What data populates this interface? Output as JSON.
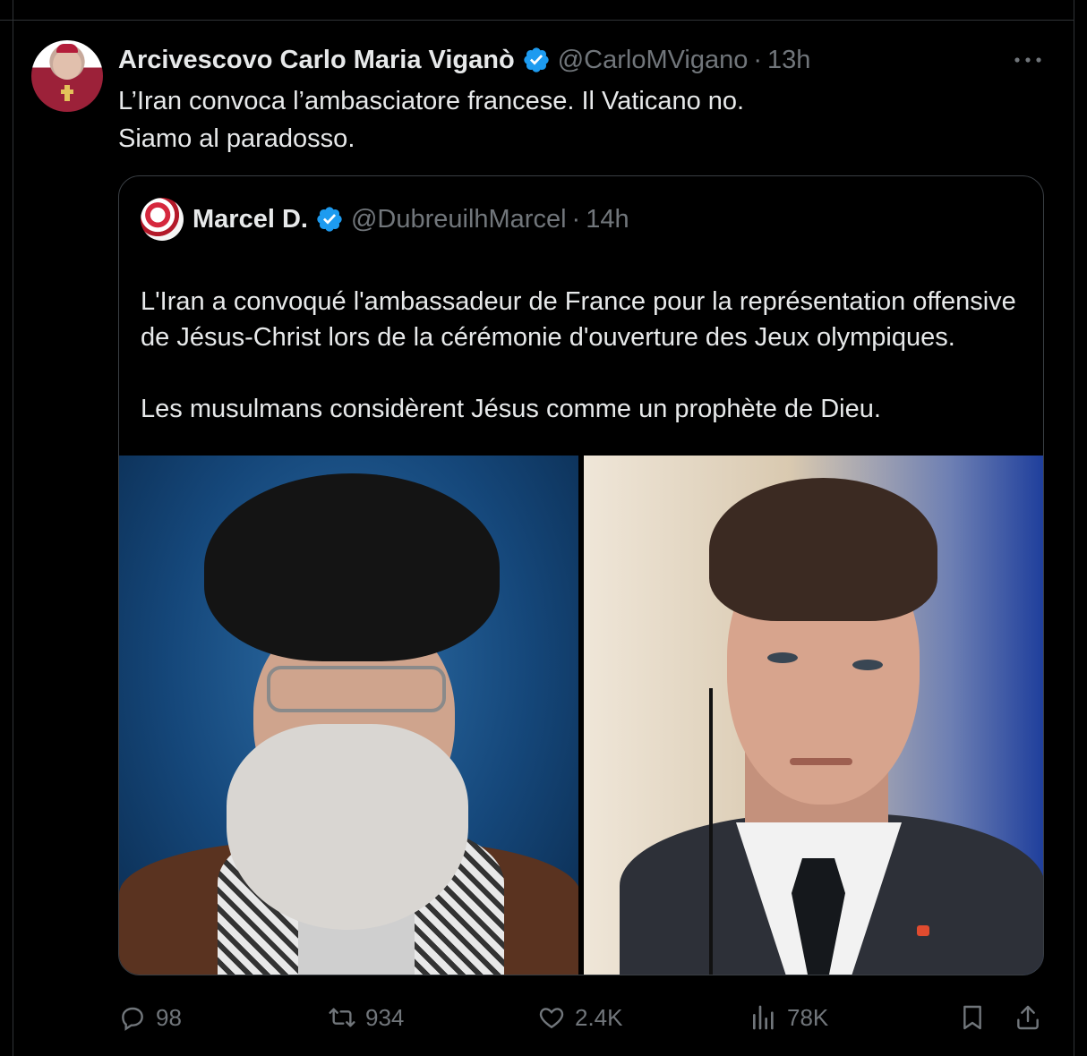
{
  "tweet": {
    "author_name": "Arcivescovo Carlo Maria Viganò",
    "handle": "@CarloMVigano",
    "separator": "·",
    "time": "13h",
    "text": "L’Iran convoca l’ambasciatore francese. Il Vaticano no.\nSiamo al paradosso."
  },
  "quoted_tweet": {
    "author_name": "Marcel D.",
    "handle": "@DubreuilhMarcel",
    "separator": "·",
    "time": "14h",
    "flag_icon": "iran-flag-icon",
    "text_p1": "L'Iran a convoqué l'ambassadeur de France pour la représentation offensive de Jésus-Christ lors de la cérémonie d'ouverture des Jeux olympiques.",
    "text_p2": "Les musulmans considèrent Jésus comme un prophète de Dieu."
  },
  "actions": {
    "replies": "98",
    "reposts": "934",
    "likes": "2.4K",
    "views": "78K"
  },
  "colors": {
    "background": "#000000",
    "text": "#e7e9ea",
    "secondary_text": "#71767b",
    "verified_badge": "#1d9bf0",
    "border": "#2f3336"
  }
}
